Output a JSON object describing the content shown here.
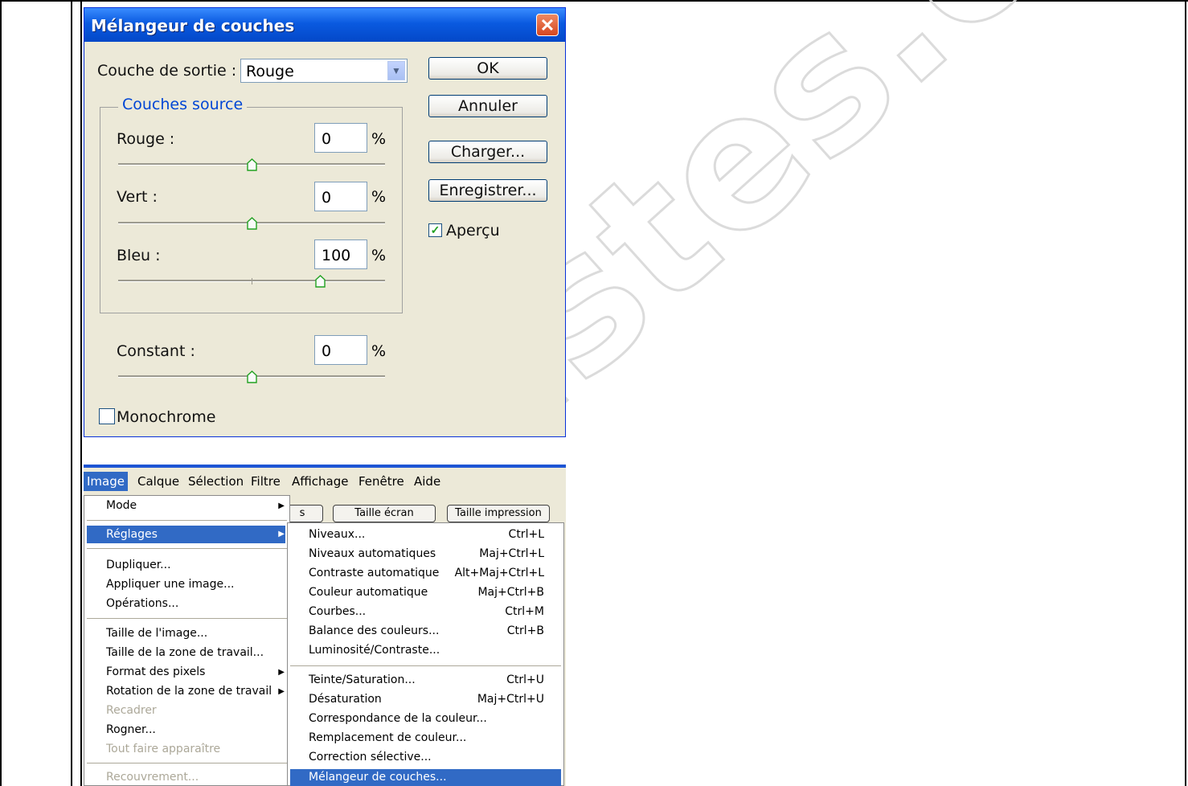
{
  "watermark": "",
  "dialog": {
    "title": "Mélangeur de couches",
    "close_glyph": "✕",
    "output_label": "Couche de sortie :",
    "output_value": "Rouge",
    "ok": "OK",
    "cancel": "Annuler",
    "load": "Charger...",
    "save": "Enregistrer...",
    "preview_label": "Aperçu",
    "preview_checked": true,
    "group_title": "Couches source",
    "channels": [
      {
        "label": "Rouge :",
        "value": "0",
        "unit": "%",
        "level": 0
      },
      {
        "label": "Vert :",
        "value": "0",
        "unit": "%",
        "level": 0
      },
      {
        "label": "Bleu :",
        "value": "100",
        "unit": "%",
        "level": 100
      }
    ],
    "constant": {
      "label": "Constant :",
      "value": "0",
      "unit": "%",
      "level": 0
    },
    "monochrome_label": "Monochrome",
    "monochrome_checked": false
  },
  "menubar": {
    "items": [
      "Image",
      "Calque",
      "Sélection",
      "Filtre",
      "Affichage",
      "Fenêtre",
      "Aide"
    ],
    "active": "Image"
  },
  "options_bar": {
    "buttons": [
      "s",
      "Taille écran",
      "Taille impression"
    ]
  },
  "image_menu": {
    "items": [
      {
        "label": "Mode",
        "submenu": true
      },
      {
        "label": "Réglages",
        "submenu": true,
        "selected": true
      },
      {
        "label": "Dupliquer..."
      },
      {
        "label": "Appliquer une image..."
      },
      {
        "label": "Opérations..."
      },
      {
        "label": "Taille de l'image..."
      },
      {
        "label": "Taille de la zone de travail..."
      },
      {
        "label": "Format des pixels",
        "submenu": true
      },
      {
        "label": "Rotation de la zone de travail",
        "submenu": true
      },
      {
        "label": "Recadrer",
        "disabled": true
      },
      {
        "label": "Rogner..."
      },
      {
        "label": "Tout faire apparaître",
        "disabled": true
      },
      {
        "label": "Recouvrement...",
        "disabled": true
      }
    ]
  },
  "adjust_menu": {
    "items": [
      {
        "label": "Niveaux...",
        "shortcut": "Ctrl+L"
      },
      {
        "label": "Niveaux automatiques",
        "shortcut": "Maj+Ctrl+L"
      },
      {
        "label": "Contraste automatique",
        "shortcut": "Alt+Maj+Ctrl+L"
      },
      {
        "label": "Couleur automatique",
        "shortcut": "Maj+Ctrl+B"
      },
      {
        "label": "Courbes...",
        "shortcut": "Ctrl+M"
      },
      {
        "label": "Balance des couleurs...",
        "shortcut": "Ctrl+B"
      },
      {
        "label": "Luminosité/Contraste...",
        "shortcut": ""
      },
      {
        "label": "Teinte/Saturation...",
        "shortcut": "Ctrl+U"
      },
      {
        "label": "Désaturation",
        "shortcut": "Maj+Ctrl+U"
      },
      {
        "label": "Correspondance de la couleur...",
        "shortcut": ""
      },
      {
        "label": "Remplacement de couleur...",
        "shortcut": ""
      },
      {
        "label": "Correction sélective...",
        "shortcut": ""
      },
      {
        "label": "Mélangeur de couches...",
        "shortcut": "",
        "selected": true
      }
    ]
  },
  "colors": {
    "titlebar": "#0a5ae0",
    "dialog_bg": "#ece9d8",
    "menu_highlight": "#316ac5",
    "group_title": "#0046d5"
  }
}
